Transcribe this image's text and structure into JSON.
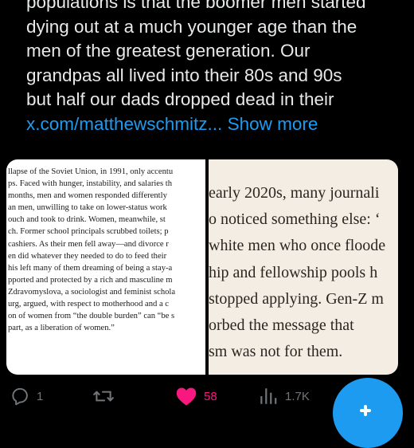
{
  "tweet": {
    "lines": [
      "populations is that the boomer men started",
      "dying out at a much younger age than the",
      "men of the greatest generation. Our",
      "grandpas all lived into their 80s and 90s",
      "but half our dads dropped dead in their"
    ],
    "link_text": "x.com/matthewschmitz...",
    "show_more": "Show more"
  },
  "media": {
    "left_image_lines": [
      "llapse of the Soviet Union, in 1991, only accentu",
      "ps. Faced with hunger, instability, and salaries th",
      " months, men and women responded differently",
      "an men, unwilling to take on lower-status work",
      "ouch and took to drink. Women, meanwhile, st",
      "ch. Former school principals scrubbed toilets; p",
      " cashiers. As their men fell away—and divorce r",
      "en did whatever they needed to do to feed their",
      "his left many of them dreaming of being a stay-a",
      "pported and protected by a rich and masculine m",
      "Zdravomyslova, a sociologist and feminist schola",
      "urg, argued, with respect to motherhood and a c",
      "on of women from “the double burden” can “be s",
      "part, as a liberation of women.”"
    ],
    "right_image_lines": [
      "early 2020s, many journali",
      "o noticed something else: ‘",
      "white men who once floode",
      "hip and fellowship pools h",
      "stopped applying. Gen-Z m",
      "orbed the message that",
      "sm was not for them."
    ]
  },
  "actions": {
    "replies": "1",
    "reposts": "",
    "likes": "58",
    "views": "1.7K"
  },
  "colors": {
    "background": "#000000",
    "text": "#e7e9ea",
    "link": "#1d9bf0",
    "like": "#f91880",
    "muted": "#71767b",
    "fab": "#1d9bf0"
  },
  "icons": [
    "reply-icon",
    "repost-icon",
    "like-icon",
    "views-icon",
    "share-icon",
    "compose-plus-icon"
  ]
}
